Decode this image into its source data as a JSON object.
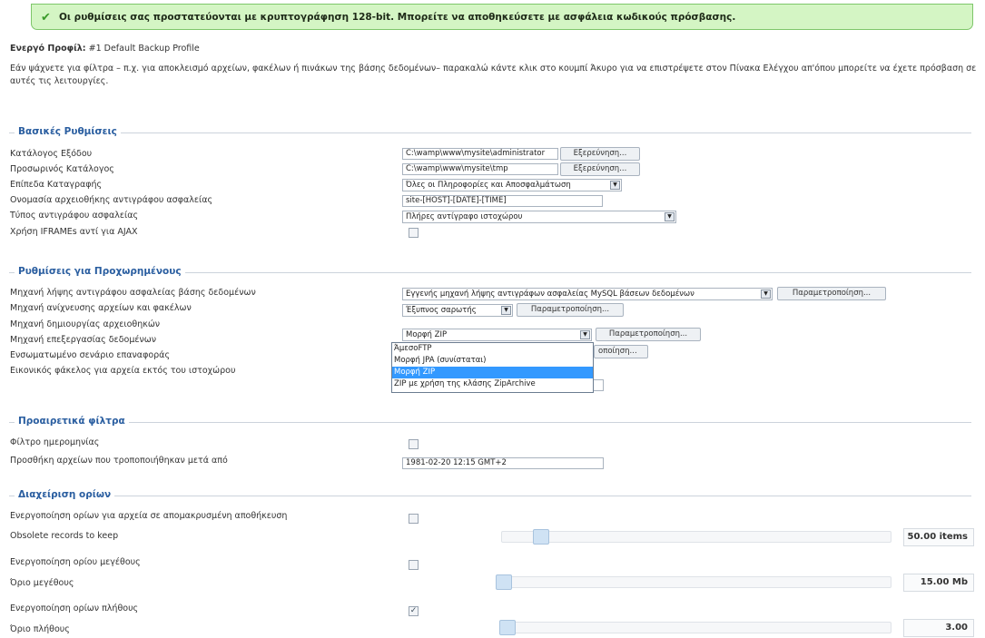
{
  "notice": {
    "text": "Οι ρυθμίσεις σας προστατεύονται με κρυπτογράφηση 128-bit. Μπορείτε να αποθηκεύσετε με ασφάλεια κωδικούς πρόσβασης."
  },
  "profile": {
    "label": "Ενεργό Προφίλ:",
    "value": "#1 Default Backup Profile"
  },
  "intro": "Εάν ψάχνετε για φίλτρα – π.χ. για αποκλεισμό αρχείων, φακέλων ή πινάκων της βάσης δεδομένων– παρακαλώ κάντε κλικ στο κουμπί Άκυρο για να επιστρέψετε στον Πίνακα Ελέγχου απ'όπου μπορείτε να έχετε πρόσβαση σε αυτές τις λειτουργίες.",
  "basic": {
    "legend": "Βασικές Ρυθμίσεις",
    "output_dir_label": "Κατάλογος Εξόδου",
    "output_dir_value": "C:\\wamp\\www\\mysite\\administrator",
    "browse1": "Εξερεύνηση...",
    "temp_dir_label": "Προσωρινός Κατάλογος",
    "temp_dir_value": "C:\\wamp\\www\\mysite\\tmp",
    "browse2": "Εξερεύνηση...",
    "log_level_label": "Επίπεδα Καταγραφής",
    "log_level_value": "Όλες οι Πληροφορίες και Αποσφαλμάτωση",
    "archive_name_label": "Ονομασία αρχειοθήκης αντιγράφου ασφαλείας",
    "archive_name_value": "site-[HOST]-[DATE]-[TIME]",
    "backup_type_label": "Τύπος αντιγράφου ασφαλείας",
    "backup_type_value": "Πλήρες αντίγραφο ιστοχώρου",
    "iframes_label": "Χρήση IFRAMEs αντί για AJAX",
    "iframes_checked": false
  },
  "advanced": {
    "legend": "Ρυθμίσεις για Προχωρημένους",
    "db_engine_label": "Μηχανή λήψης αντιγράφου ασφαλείας βάσης δεδομένων",
    "db_engine_value": "Εγγενής μηχανή λήψης αντιγράφων ασφαλείας MySQL βάσεων δεδομένων",
    "configure1": "Παραμετροποίηση...",
    "scan_engine_label": "Μηχανή ανίχνευσης αρχείων και φακέλων",
    "scan_engine_value": "Έξυπνος σαρωτής",
    "configure2": "Παραμετροποίηση...",
    "archiver_label": "Μηχανή δημιουργίας αρχειοθηκών",
    "archiver_value": "Μορφή ZIP",
    "configure3": "Παραμετροποίηση...",
    "processing_label": "Μηχανή επεξεργασίας δεδομένων",
    "configure4_partial": "οποίηση...",
    "restore_label": "Ενσωματωμένο σενάριο επαναφοράς",
    "virtual_label": "Εικονικός φάκελος για αρχεία εκτός του ιστοχώρου",
    "archiver_options": [
      "ΆμεσοFTP",
      "Μορφή JPA (συνίσταται)",
      "Μορφή ZIP",
      "ZIP με χρήση της κλάσης ZipArchive"
    ],
    "archiver_selected_index": 2
  },
  "filters": {
    "legend": "Προαιρετικά φίλτρα",
    "date_filter_label": "Φίλτρο ημερομηνίας",
    "date_filter_checked": false,
    "modified_label": "Προσθήκη αρχείων που τροποποιήθηκαν μετά από",
    "modified_value": "1981-02-20 12:15 GMT+2"
  },
  "quotas": {
    "legend": "Διαχείριση ορίων",
    "remote_label": "Ενεργοποίηση ορίων για αρχεία σε απομακρυσμένη αποθήκευση",
    "remote_checked": false,
    "obsolete_label": "Obsolete records to keep",
    "obsolete_value": "50.00 items",
    "size_enable_label": "Ενεργοποίηση ορίου μεγέθους",
    "size_checked": false,
    "size_label": "Όριο μεγέθους",
    "size_value": "15.00 Mb",
    "count_enable_label": "Ενεργοποίηση ορίων πλήθους",
    "count_checked": true,
    "count_label": "Όριο πλήθους",
    "count_value": "3.00"
  }
}
